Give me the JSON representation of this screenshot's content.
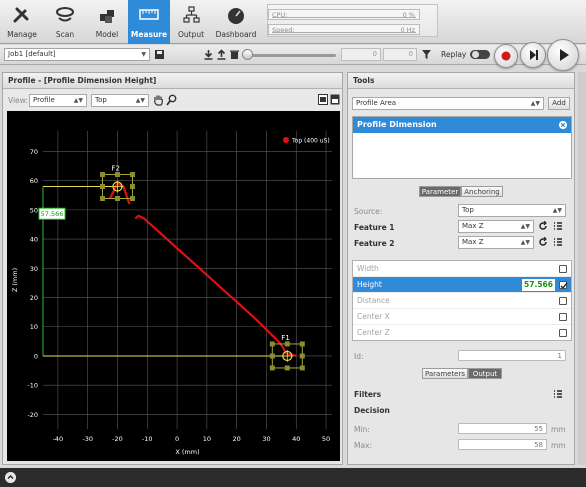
{
  "nav": {
    "items": [
      {
        "label": "Manage",
        "icon": "wrench-screwdriver-icon"
      },
      {
        "label": "Scan",
        "icon": "scan-icon"
      },
      {
        "label": "Model",
        "icon": "model-cubes-icon"
      },
      {
        "label": "Measure",
        "icon": "measure-ruler-icon"
      },
      {
        "label": "Output",
        "icon": "output-network-icon"
      },
      {
        "label": "Dashboard",
        "icon": "gauge-icon"
      }
    ],
    "active": "Measure"
  },
  "status": {
    "cpu_label": "CPU:",
    "cpu_value": "0 %",
    "speed_label": "Speed:",
    "speed_value": "0 Hz"
  },
  "jobbar": {
    "job": "Job1 [default]",
    "frame_value": "0",
    "frame_total": "0",
    "replay_label": "Replay"
  },
  "profile_panel": {
    "title": "Profile - [Profile Dimension Height]",
    "view_label": "View:",
    "view_mode": "Profile",
    "view_source": "Top"
  },
  "tools_panel": {
    "title": "Tools",
    "tool_type": "Profile Area",
    "add_label": "Add",
    "selected_tool": "Profile Dimension",
    "tabs1": [
      "Parameter",
      "Anchoring"
    ],
    "source_label": "Source:",
    "source_value": "Top",
    "feature1_label": "Feature 1",
    "feature1_value": "Max Z",
    "feature2_label": "Feature 2",
    "feature2_value": "Max Z",
    "measurements": [
      {
        "label": "Width",
        "checked": false,
        "value": ""
      },
      {
        "label": "Height",
        "checked": true,
        "value": "57.566"
      },
      {
        "label": "Distance",
        "checked": false,
        "value": ""
      },
      {
        "label": "Center X",
        "checked": false,
        "value": ""
      },
      {
        "label": "Center Z",
        "checked": false,
        "value": ""
      }
    ],
    "id_label": "Id:",
    "id_value": "1",
    "tabs2": [
      "Parameters",
      "Output"
    ],
    "filters_label": "Filters",
    "decision_label": "Decision",
    "min_label": "Min:",
    "min_value": "55",
    "max_label": "Max:",
    "max_value": "58",
    "unit": "mm"
  },
  "chart_data": {
    "type": "line",
    "title": "",
    "xlabel": "X (mm)",
    "ylabel": "Z (mm)",
    "xlim": [
      -45,
      52
    ],
    "ylim": [
      -25,
      77
    ],
    "xticks": [
      -40,
      -30,
      -20,
      -10,
      0,
      10,
      20,
      30,
      40,
      50
    ],
    "yticks": [
      -20,
      -10,
      0,
      10,
      20,
      30,
      40,
      50,
      60,
      70
    ],
    "grid": true,
    "legend": {
      "entries": [
        "Top (400 uS)"
      ],
      "placement": "top-right"
    },
    "series": [
      {
        "name": "Top (400 uS)",
        "color": "#e01010",
        "x": [
          -22.5,
          -20,
          -18,
          -16
        ],
        "y": [
          54,
          59,
          58,
          52
        ]
      },
      {
        "name": "Top (400 uS)",
        "color": "#e01010",
        "x": [
          -14,
          -13,
          -11,
          26,
          34,
          35.5,
          36.5,
          37.5,
          38.5,
          40
        ],
        "y": [
          47,
          48,
          47,
          13,
          5,
          3,
          1,
          0.5,
          0.5,
          0
        ]
      }
    ],
    "annotations": {
      "f1_label": "F1",
      "f1_point": [
        37,
        0
      ],
      "f2_label": "F2",
      "f2_point": [
        -20,
        58
      ],
      "height_value": "57.566",
      "height_line_x": -45
    }
  }
}
